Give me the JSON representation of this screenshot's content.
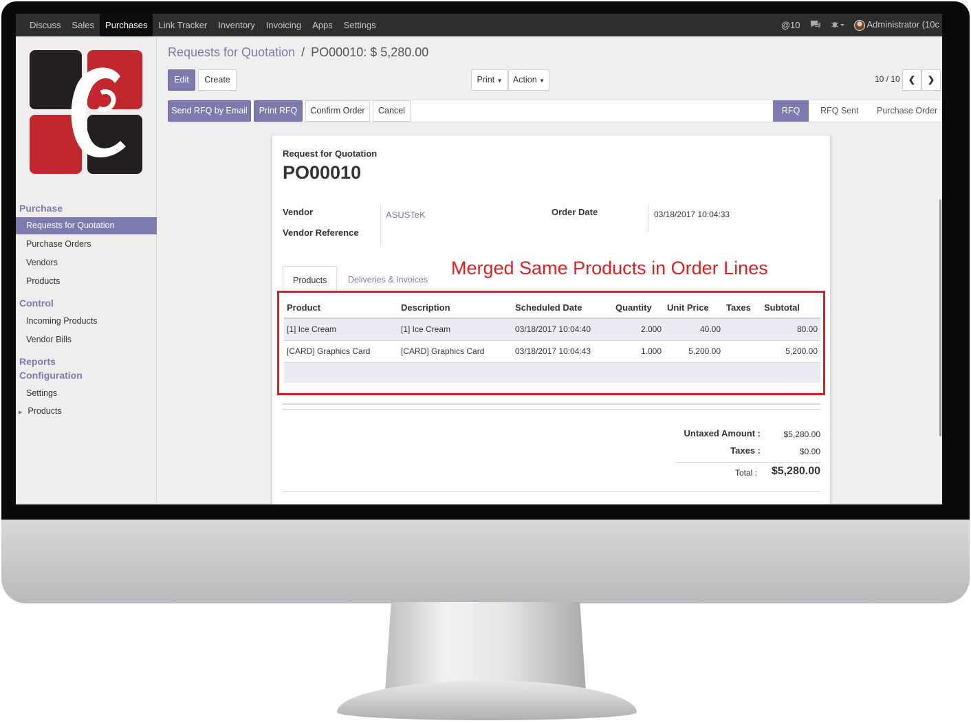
{
  "topbar": {
    "menu": [
      "Discuss",
      "Sales",
      "Purchases",
      "Link Tracker",
      "Inventory",
      "Invoicing",
      "Apps",
      "Settings"
    ],
    "mentions": "@10",
    "user": "Administrator (10c"
  },
  "sidebar": {
    "section_purchase": "Purchase",
    "items_purchase": [
      "Requests for Quotation",
      "Purchase Orders",
      "Vendors",
      "Products"
    ],
    "section_control": "Control",
    "items_control": [
      "Incoming Products",
      "Vendor Bills"
    ],
    "section_reports": "Reports",
    "section_config": "Configuration",
    "items_config": [
      "Settings",
      "Products"
    ]
  },
  "breadcrumb": {
    "parent": "Requests for Quotation",
    "separator": "/",
    "current": "PO00010: $ 5,280.00"
  },
  "toolbar": {
    "edit": "Edit",
    "create": "Create",
    "print": "Print",
    "action": "Action",
    "pager": "10 / 10"
  },
  "statusbar": {
    "send_rfq": "Send RFQ by Email",
    "print_rfq": "Print RFQ",
    "confirm": "Confirm Order",
    "cancel": "Cancel",
    "stages": [
      "RFQ",
      "RFQ Sent",
      "Purchase Order"
    ],
    "active_stage": "RFQ"
  },
  "form": {
    "subtitle": "Request for Quotation",
    "name": "PO00010",
    "vendor_label": "Vendor",
    "vendor_value": "ASUSTeK",
    "vendor_ref_label": "Vendor Reference",
    "order_date_label": "Order Date",
    "order_date_value": "03/18/2017 10:04:33",
    "tabs": [
      "Products",
      "Deliveries & Invoices"
    ],
    "annotation": "Merged Same Products in Order Lines"
  },
  "order_lines": {
    "headers": [
      "Product",
      "Description",
      "Scheduled Date",
      "Quantity",
      "Unit Price",
      "Taxes",
      "Subtotal"
    ],
    "rows": [
      [
        "[1] Ice Cream",
        "[1] Ice Cream",
        "03/18/2017 10:04:40",
        "2.000",
        "40.00",
        "",
        "80.00"
      ],
      [
        "[CARD] Graphics Card",
        "[CARD] Graphics Card",
        "03/18/2017 10:04:43",
        "1.000",
        "5,200.00",
        "",
        "5,200.00"
      ]
    ]
  },
  "totals": {
    "untaxed_label": "Untaxed Amount :",
    "untaxed_value": "$5,280.00",
    "taxes_label": "Taxes :",
    "taxes_value": "$0.00",
    "total_label": "Total :",
    "total_value": "$5,280.00"
  },
  "colors": {
    "accent": "#7c7bad",
    "annotation_red": "#e01b24",
    "topbar": "#2e2e30"
  }
}
